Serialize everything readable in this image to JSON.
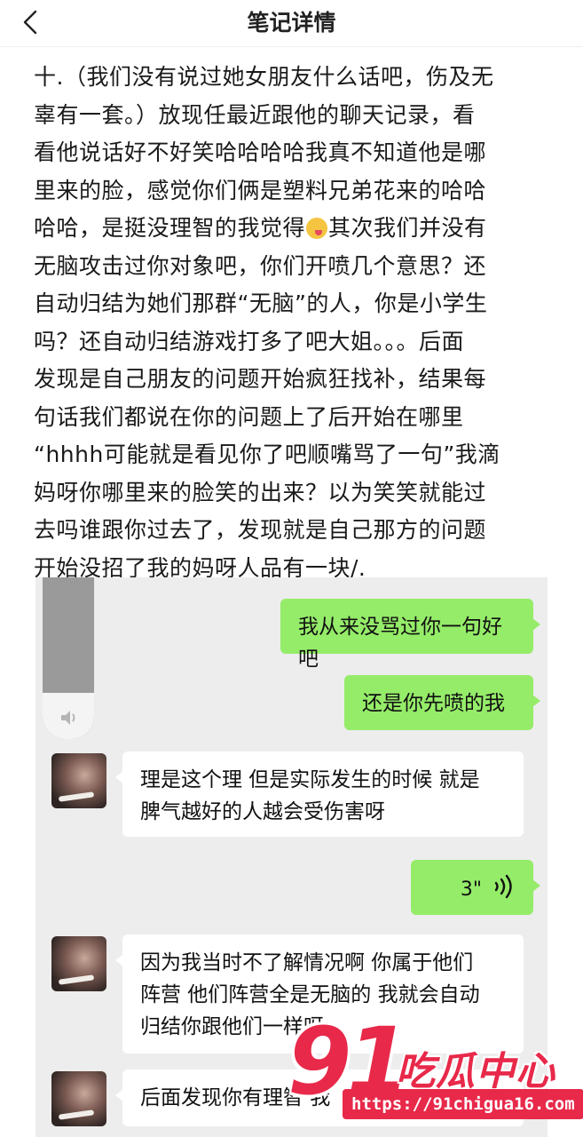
{
  "header": {
    "title": "笔记详情",
    "back_icon": "chevron-left-icon"
  },
  "note": {
    "lines": [
      "十.（我们没有说过她女朋友什么话吧，伤及无",
      "辜有一套。）放现任最近跟他的聊天记录，看",
      "看他说话好不好笑哈哈哈哈我真不知道他是哪",
      "里来的脸，感觉你们俩是塑料兄弟花来的哈哈",
      "哈哈，是挺没理智的我觉得",
      "其次我们并没有",
      "无脑攻击过你对象吧，你们开喷几个意思？还",
      "自动归结为她们那群“无脑”的人，你是小学生",
      "吗？还自动归结游戏打多了吧大姐。。。后面",
      "发现是自己朋友的问题开始疯狂找补，结果每",
      "句话我们都说在你的问题上了后开始在哪里",
      "“hhhh可能就是看见你了吧顺嘴骂了一句”我滴",
      "妈呀你哪里来的脸笑的出来？以为笑笑就能过",
      "去吗谁跟你过去了，发现就是自己那方的问题",
      "开始没招了我的妈呀人品有一块/."
    ],
    "emoji": "crazy-face-emoji"
  },
  "chat": {
    "messages": [
      {
        "side": "out",
        "type": "text",
        "lines": [
          "我从来没骂过你一句好吧"
        ]
      },
      {
        "side": "out",
        "type": "text",
        "lines": [
          "还是你先喷的我"
        ]
      },
      {
        "side": "in",
        "type": "text",
        "lines": [
          "理是这个理 但是实际发生的时候 就是",
          "脾气越好的人越会受伤害呀"
        ]
      },
      {
        "side": "out",
        "type": "voice",
        "duration": "3\""
      },
      {
        "side": "in",
        "type": "text",
        "lines": [
          "因为我当时不了解情况啊 你属于他们",
          "阵营 他们阵营全是无脑的 我就会自动",
          "归结你跟他们一样呀"
        ]
      },
      {
        "side": "in",
        "type": "text",
        "lines": [
          "后面发现你有理智 我"
        ]
      }
    ],
    "colors": {
      "outgoing": "#95ec69",
      "incoming": "#ffffff",
      "background": "#ededed"
    }
  },
  "watermark": {
    "number": "91",
    "brand": "吃瓜中心",
    "url": "https://91chigua16.com",
    "color": "#e8294a"
  }
}
